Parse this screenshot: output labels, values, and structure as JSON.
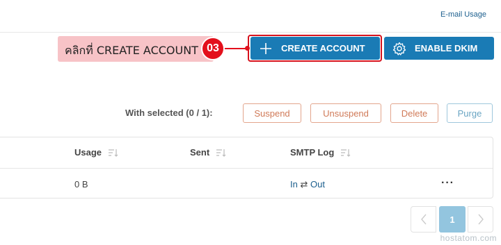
{
  "header": {
    "email_usage_link": "E-mail Usage"
  },
  "tutorial": {
    "callout_text": "คลิกที่ CREATE ACCOUNT",
    "step_number": "03",
    "highlight_color": "#d6121d"
  },
  "toolbar": {
    "create_account_label": "CREATE ACCOUNT",
    "create_account_icon": "plus-icon",
    "enable_dkim_label": "ENABLE DKIM",
    "enable_dkim_icon": "gear-icon",
    "primary_color": "#1a7bb5"
  },
  "bulk_actions": {
    "with_selected_label": "With selected (0 / 1):",
    "buttons": [
      "Suspend",
      "Unsuspend",
      "Delete",
      "Purge"
    ]
  },
  "table": {
    "columns": [
      "Usage",
      "Sent",
      "SMTP Log"
    ],
    "rows": [
      {
        "usage": "0 B",
        "sent": "",
        "smtp_in": "In",
        "smtp_sep": "⇄",
        "smtp_out": "Out",
        "menu": "···"
      }
    ]
  },
  "pagination": {
    "current_page": "1",
    "prev": "‹",
    "next": "›"
  },
  "watermark": "hostatom.com"
}
